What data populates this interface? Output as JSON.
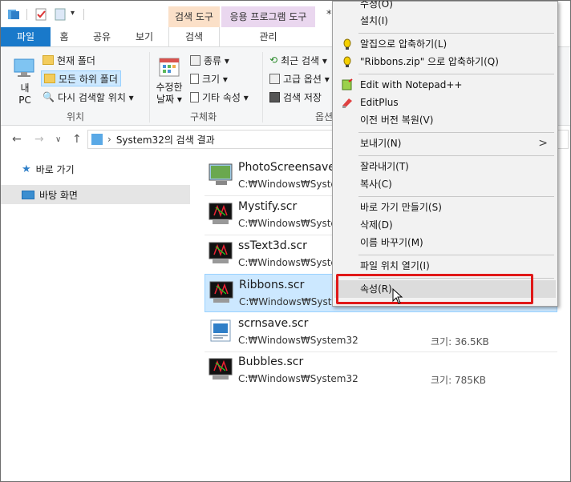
{
  "title_bar": {
    "contextual_tabs": [
      "검색 도구",
      "응용 프로그램 도구"
    ],
    "overflow": "*"
  },
  "ribbon_tabs": {
    "file": "파일",
    "home": "홈",
    "share": "공유",
    "view": "보기",
    "search": "검색",
    "manage": "관리"
  },
  "ribbon": {
    "location": {
      "this_pc": "내\nPC",
      "current_folder": "현재 폴더",
      "all_subfolders": "모든 하위 폴더",
      "search_again": "다시 검색할 위치 ▾",
      "label": "위치"
    },
    "refine": {
      "date_modified": "수정한\n날짜 ▾",
      "kind": "종류 ▾",
      "size": "크기 ▾",
      "other": "기타 속성 ▾",
      "label": "구체화"
    },
    "options": {
      "recent": "최근 검색 ▾",
      "advanced": "고급 옵션 ▾",
      "save": "검색 저장",
      "label": "옵션"
    }
  },
  "address": {
    "path_root": "›",
    "path": "System32의 검색 결과"
  },
  "nav": {
    "quick_access": "바로 가기",
    "desktop": "바탕 화면"
  },
  "results": [
    {
      "name": "PhotoScreensave",
      "path": "C:₩Windows₩Syster",
      "size": ""
    },
    {
      "name": "Mystify.scr",
      "path": "C:₩Windows₩Syster",
      "size": ""
    },
    {
      "name": "ssText3d.scr",
      "path": "C:₩Windows₩Syster",
      "size": ""
    },
    {
      "name": "Ribbons.scr",
      "path": "C:₩Windows₩Syste",
      "size": ""
    },
    {
      "name": "scrnsave.scr",
      "path": "C:₩Windows₩System32",
      "size": "크기: 36.5KB"
    },
    {
      "name": "Bubbles.scr",
      "path": "C:₩Windows₩System32",
      "size": "크기: 785KB"
    }
  ],
  "context_menu": {
    "items": [
      {
        "label": "수정(O)",
        "icon": ""
      },
      {
        "label": "설치(I)",
        "icon": ""
      },
      {
        "label": "알집으로 압축하기(L)",
        "icon": "alzip-icon"
      },
      {
        "label": "\"Ribbons.zip\" 으로 압축하기(Q)",
        "icon": "alzip-icon"
      },
      {
        "label": "Edit with Notepad++",
        "icon": "notepadpp-icon"
      },
      {
        "label": "EditPlus",
        "icon": "editplus-icon"
      },
      {
        "label": "이전 버전 복원(V)",
        "icon": ""
      },
      {
        "label": "보내기(N)",
        "icon": ""
      },
      {
        "label": "잘라내기(T)",
        "icon": ""
      },
      {
        "label": "복사(C)",
        "icon": ""
      },
      {
        "label": "바로 가기 만들기(S)",
        "icon": ""
      },
      {
        "label": "삭제(D)",
        "icon": ""
      },
      {
        "label": "이름 바꾸기(M)",
        "icon": ""
      },
      {
        "label": "파일 위치 열기(I)",
        "icon": ""
      },
      {
        "label": "속성(R)",
        "icon": ""
      }
    ],
    "submenu_arrow": ">"
  },
  "colors": {
    "file_tab": "#1979ca",
    "selection": "#cce8ff",
    "contextual_search": "#fbe0c8",
    "contextual_app": "#ead7ef",
    "highlight_box": "#e01818"
  }
}
